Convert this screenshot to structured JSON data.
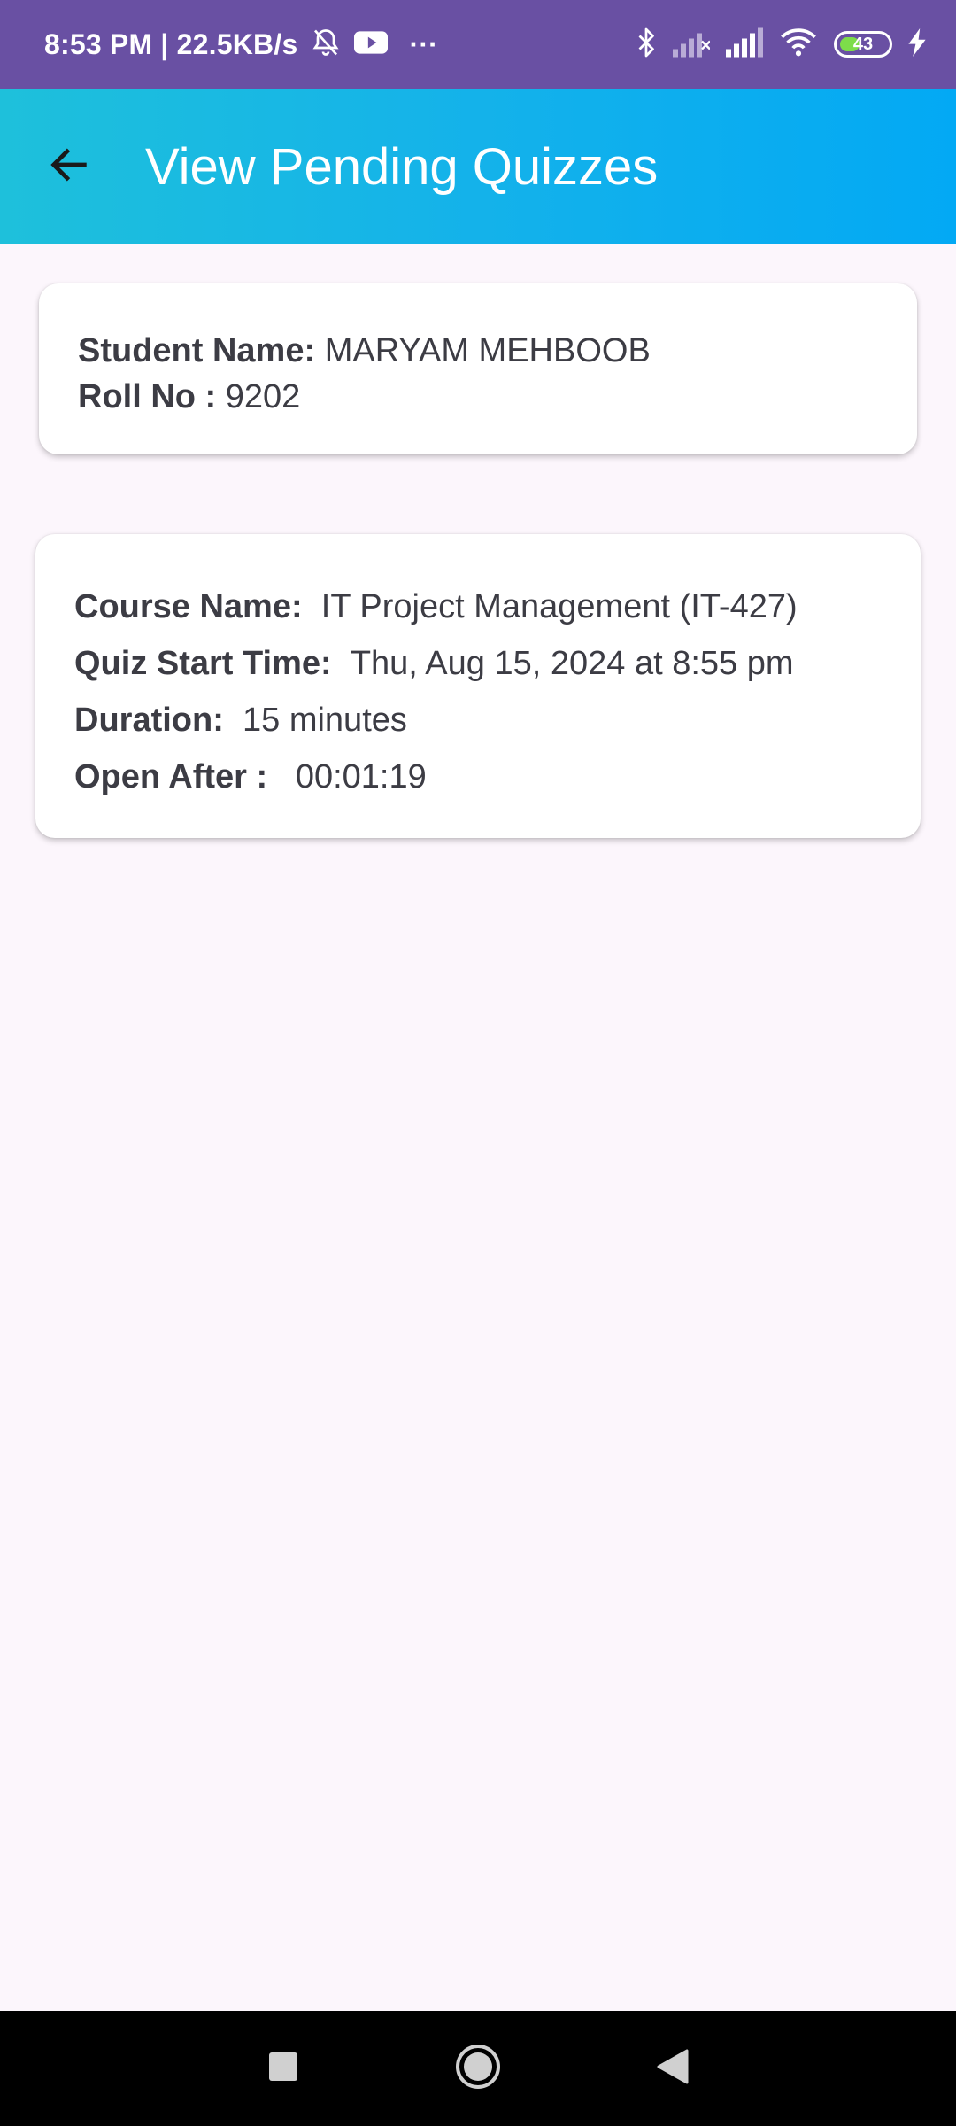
{
  "status_bar": {
    "time_speed": "8:53 PM | 22.5KB/s",
    "more": "···",
    "battery_level": "43",
    "battery_fraction": 0.43,
    "icons": [
      "alarm-off-icon",
      "youtube-icon",
      "bluetooth-icon",
      "signal-weak-icon",
      "signal-icon",
      "wifi-icon",
      "battery-icon",
      "charging-icon"
    ]
  },
  "app_bar": {
    "title": "View Pending Quizzes",
    "back_icon": "arrow-left-icon"
  },
  "student": {
    "name_label": "Student Name:",
    "name_value": "MARYAM MEHBOOB",
    "roll_label": "Roll No :",
    "roll_value": "9202"
  },
  "quizzes": [
    {
      "course_label": "Course Name:",
      "course_value": "IT Project Management (IT-427)",
      "start_label": "Quiz Start Time:",
      "start_value": "Thu, Aug 15, 2024 at 8:55 pm",
      "duration_label": "Duration:",
      "duration_value": "15 minutes",
      "open_label": "Open After :",
      "open_value": "00:01:19"
    }
  ],
  "nav_bar": {
    "icons": [
      "recents-square-icon",
      "home-circle-icon",
      "back-triangle-icon"
    ]
  },
  "colors": {
    "status_bar": "#6950a3",
    "app_bar_start": "#1ec0db",
    "app_bar_end": "#03a9f4",
    "page_background": "#fcf6fc",
    "card": "#ffffff",
    "text": "#3c3c44"
  }
}
